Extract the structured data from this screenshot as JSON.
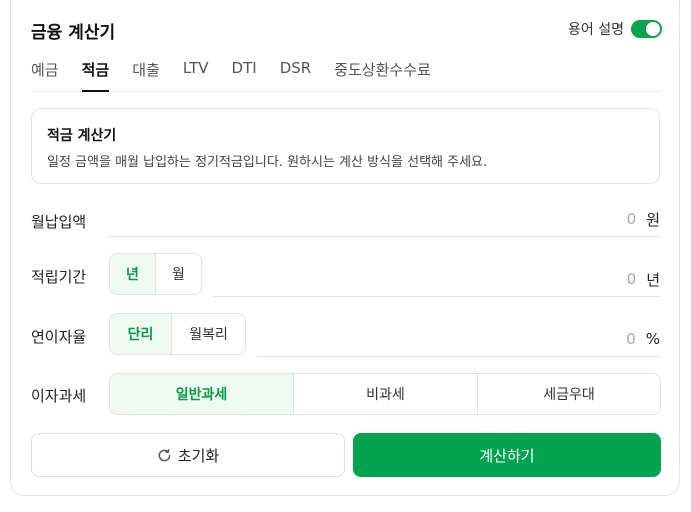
{
  "header": {
    "title": "금융 계산기",
    "glossary_label": "용어 설명",
    "glossary_on": true
  },
  "tabs": [
    {
      "label": "예금",
      "active": false
    },
    {
      "label": "적금",
      "active": true
    },
    {
      "label": "대출",
      "active": false
    },
    {
      "label": "LTV",
      "active": false
    },
    {
      "label": "DTI",
      "active": false
    },
    {
      "label": "DSR",
      "active": false
    },
    {
      "label": "중도상환수수료",
      "active": false
    }
  ],
  "info": {
    "title": "적금 계산기",
    "description": "일정 금액을 매월 납입하는 정기적금입니다. 원하시는 계산 방식을 선택해 주세요."
  },
  "form": {
    "monthly_payment": {
      "label": "월납입액",
      "value": "0",
      "unit": "원"
    },
    "period": {
      "label": "적립기간",
      "options": [
        "년",
        "월"
      ],
      "selected": "년",
      "value": "0",
      "unit": "년"
    },
    "rate": {
      "label": "연이자율",
      "options": [
        "단리",
        "월복리"
      ],
      "selected": "단리",
      "value": "0",
      "unit": "%"
    },
    "tax": {
      "label": "이자과세",
      "options": [
        "일반과세",
        "비과세",
        "세금우대"
      ],
      "selected": "일반과세"
    }
  },
  "actions": {
    "reset_label": "초기화",
    "calculate_label": "계산하기"
  },
  "colors": {
    "accent": "#04a34d",
    "accent_light": "#effaf3"
  }
}
